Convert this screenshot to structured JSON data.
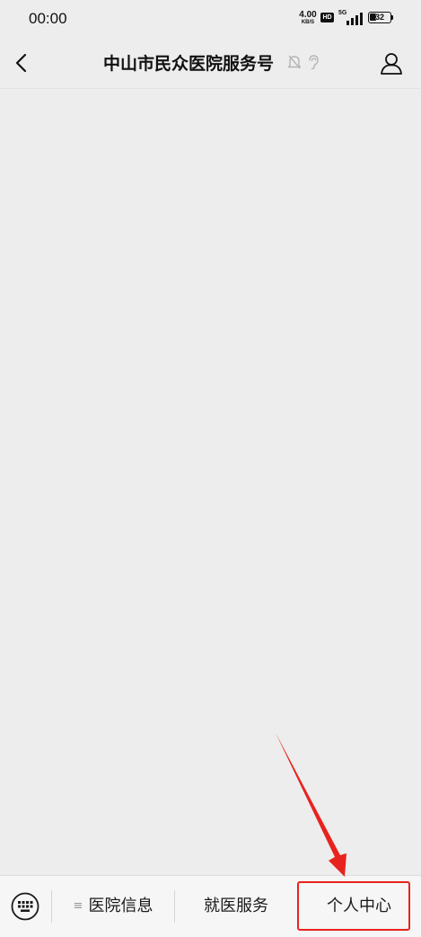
{
  "status_bar": {
    "time": "00:00",
    "net_speed_value": "4.00",
    "net_speed_unit": "KB/S",
    "hd_badge": "HD",
    "network_type": "5G",
    "battery_level": "32",
    "battery_fraction": 0.32
  },
  "header": {
    "title": "中山市民众医院服务号",
    "back_icon": "chevron-left-icon",
    "mute_icon": "bell-off-icon",
    "ear_icon": "earpiece-icon",
    "profile_icon": "person-icon"
  },
  "bottom_menu": {
    "keyboard_icon": "keyboard-icon",
    "items": [
      {
        "label": "医院信息",
        "has_submenu": true
      },
      {
        "label": "就医服务",
        "has_submenu": false
      },
      {
        "label": "个人中心",
        "has_submenu": false
      }
    ]
  },
  "annotation": {
    "color": "#e8231e",
    "target": "个人中心"
  }
}
